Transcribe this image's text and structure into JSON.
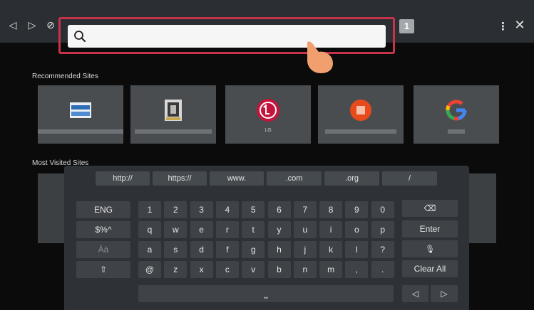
{
  "toolbar": {
    "back_icon": "◁",
    "forward_icon": "▷",
    "stop_icon": "⊘",
    "url_value": "",
    "tab_count": "1",
    "more_icon": "⋮",
    "close_icon": "✕"
  },
  "recommended": {
    "label": "Recommended Sites",
    "tiles": [
      {
        "icon": "blurred-site-icon",
        "label": ""
      },
      {
        "icon": "blurred-site-icon",
        "label": ""
      },
      {
        "icon": "lg-logo-icon",
        "label": "LG"
      },
      {
        "icon": "blurred-site-icon",
        "label": ""
      },
      {
        "icon": "google-logo-icon",
        "label": ""
      }
    ]
  },
  "most_visited": {
    "label": "Most Visited Sites"
  },
  "keyboard": {
    "quick_keys": [
      "http://",
      "https://",
      "www.",
      ".com",
      ".org",
      "/"
    ],
    "row1": [
      "ENG",
      "1",
      "2",
      "3",
      "4",
      "5",
      "6",
      "7",
      "8",
      "9",
      "0"
    ],
    "row2": [
      "$%^",
      "q",
      "w",
      "e",
      "r",
      "t",
      "y",
      "u",
      "i",
      "o",
      "p"
    ],
    "row3": [
      "Àà",
      "a",
      "s",
      "d",
      "f",
      "g",
      "h",
      "j",
      "k",
      "l",
      "?"
    ],
    "row4": [
      "⇧",
      "@",
      "z",
      "x",
      "c",
      "v",
      "b",
      "n",
      "m",
      ",",
      "."
    ],
    "backspace_icon": "⌫",
    "enter_label": "Enter",
    "mic_icon": "🎙",
    "clear_all_label": "Clear All",
    "space_icon": "⎵",
    "cursor_left_icon": "◁",
    "cursor_right_icon": "▷"
  },
  "colors": {
    "focus_border": "#c8334c",
    "lg_red": "#c4143c",
    "pointer": "#f29f70"
  }
}
